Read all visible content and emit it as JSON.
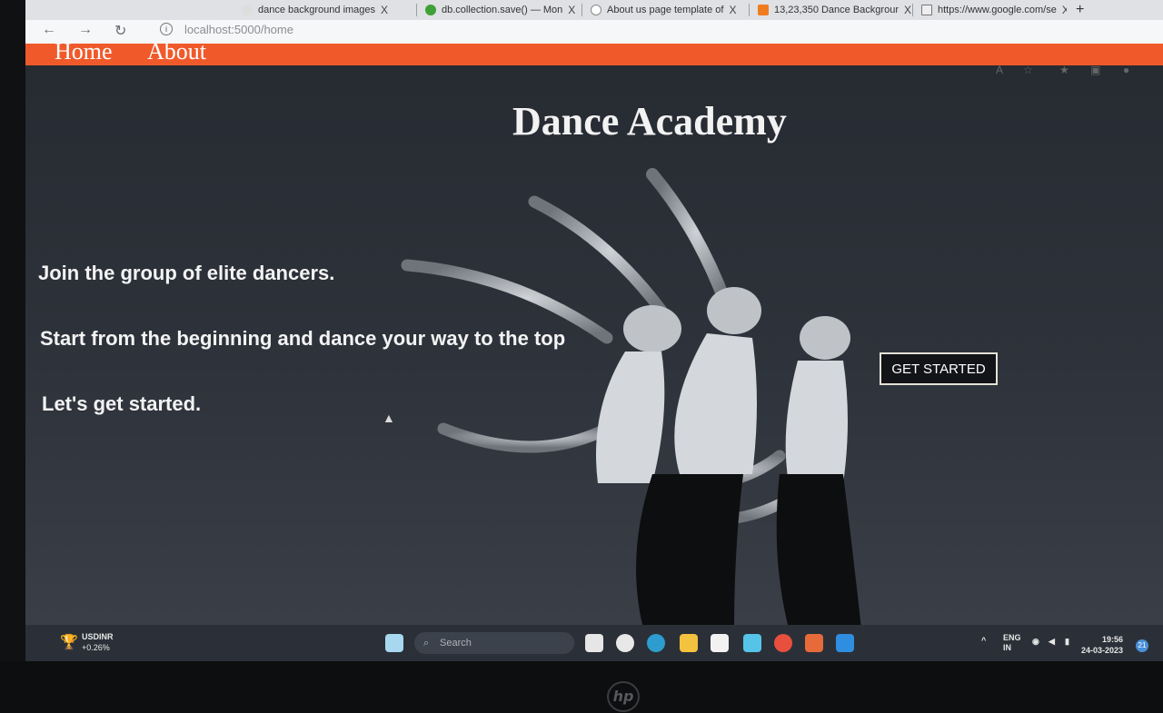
{
  "browser": {
    "tabs": [
      {
        "label": "dance background images",
        "close": "X"
      },
      {
        "label": "db.collection.save() — Mon",
        "close": "X"
      },
      {
        "label": "About us page template of",
        "close": "X"
      },
      {
        "label": "13,23,350 Dance Backgrour",
        "close": "X"
      },
      {
        "label": "https://www.google.com/se",
        "close": "X"
      }
    ],
    "new_tab": "+",
    "url": "localhost:5000/home"
  },
  "nav": {
    "home": "Home",
    "about": "About"
  },
  "hero": {
    "title": "Dance Academy",
    "line1": "Join the group of elite dancers.",
    "line2": "Start from the beginning and dance your way to the top",
    "line3": "Let's get started.",
    "cta": "GET STARTED"
  },
  "taskbar": {
    "ticker_symbol": "USDINR",
    "ticker_change": "+0.26%",
    "search_placeholder": "Search",
    "lang_top": "ENG",
    "lang_bottom": "IN",
    "time": "19:56",
    "date": "24-03-2023",
    "notification_count": "21"
  },
  "colors": {
    "navbar": "#f05a2b",
    "page_bg": "#262a31",
    "cta_border": "#e6e1d6"
  }
}
